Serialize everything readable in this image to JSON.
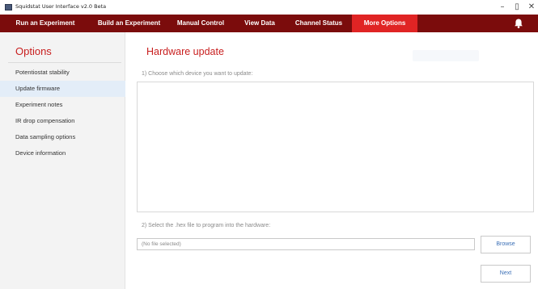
{
  "window": {
    "title": "Squidstat User Interface v2.0 Beta",
    "controls": {
      "minimize": "–",
      "maximize": "▯",
      "close": "✕"
    }
  },
  "nav": {
    "items": [
      {
        "label": "Run an Experiment"
      },
      {
        "label": "Build an Experiment"
      },
      {
        "label": "Manual Control"
      },
      {
        "label": "View Data"
      },
      {
        "label": "Channel Status"
      },
      {
        "label": "More Options",
        "active": true
      }
    ],
    "notifications_icon": "bell-icon"
  },
  "sidebar": {
    "title": "Options",
    "items": [
      {
        "label": "Potentiostat stability"
      },
      {
        "label": "Update firmware",
        "selected": true
      },
      {
        "label": "Experiment notes"
      },
      {
        "label": "IR drop compensation"
      },
      {
        "label": "Data sampling options"
      },
      {
        "label": "Device information"
      }
    ]
  },
  "main": {
    "title": "Hardware update",
    "step1_label": "1) Choose which device you want to update:",
    "step2_label": "2) Select the .hex file to program into the hardware:",
    "file_field_value": "(No file selected)",
    "browse_label": "Browse",
    "next_label": "Next"
  },
  "colors": {
    "navbar": "#7b0c0c",
    "nav_active": "#e02424",
    "accent_red": "#c81e1e",
    "button_text": "#3b6fb6",
    "sidebar_selected": "#e3edf8"
  }
}
